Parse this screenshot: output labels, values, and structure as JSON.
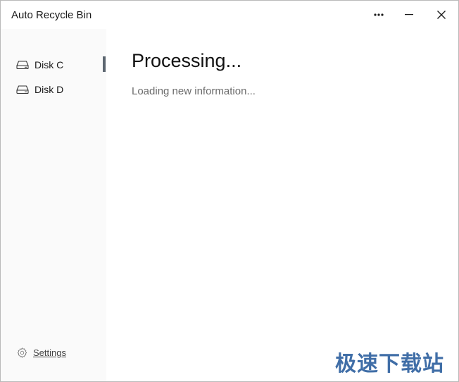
{
  "window": {
    "title": "Auto Recycle Bin",
    "controls": {
      "more_icon": "ellipsis-icon",
      "minimize_icon": "minimize-icon",
      "close_icon": "close-icon"
    }
  },
  "sidebar": {
    "items": [
      {
        "label": "Disk C",
        "icon": "drive-icon",
        "active": true
      },
      {
        "label": "Disk D",
        "icon": "drive-icon",
        "active": false
      }
    ],
    "settings": {
      "label": "Settings",
      "icon": "gear-icon"
    }
  },
  "main": {
    "heading": "Processing...",
    "subtext": "Loading new information..."
  },
  "watermark": {
    "text": "极速下载站"
  },
  "colors": {
    "active_indicator": "#5c6670",
    "sidebar_bg": "#fafafa",
    "watermark": "#2c5f9e"
  }
}
